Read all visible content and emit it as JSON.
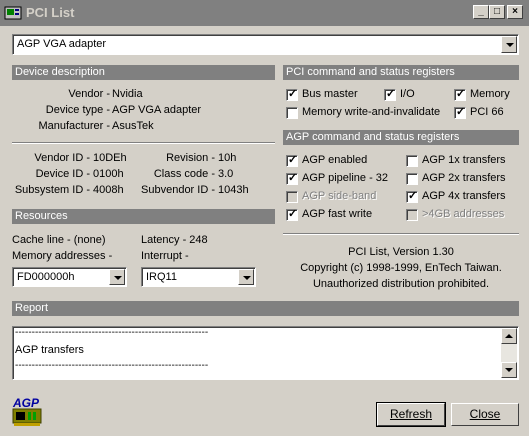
{
  "window": {
    "title": "PCI List"
  },
  "device_select": {
    "value": "AGP VGA adapter"
  },
  "device_description": {
    "header": "Device description",
    "vendor_label": "Vendor -",
    "vendor": "Nvidia",
    "type_label": "Device type -",
    "type": "AGP VGA adapter",
    "manufacturer_label": "Manufacturer -",
    "manufacturer": "AsusTek"
  },
  "ids": {
    "vendor_id_label": "Vendor ID -",
    "vendor_id": "10DEh",
    "device_id_label": "Device ID -",
    "device_id": "0100h",
    "subsystem_id_label": "Subsystem ID -",
    "subsystem_id": "4008h",
    "revision_label": "Revision -",
    "revision": "10h",
    "class_code_label": "Class code -",
    "class_code": "3.0",
    "subvendor_id_label": "Subvendor ID -",
    "subvendor_id": "1043h"
  },
  "resources": {
    "header": "Resources",
    "cache_line": "Cache line - (none)",
    "latency": "Latency - 248",
    "memory_addresses_label": "Memory addresses -",
    "interrupt_label": "Interrupt -",
    "memory_value": "FD000000h",
    "interrupt_value": "IRQ11"
  },
  "pci_registers": {
    "header": "PCI command and status registers",
    "items": [
      {
        "label": "Bus master",
        "checked": true,
        "disabled": false
      },
      {
        "label": "I/O",
        "checked": true,
        "disabled": false
      },
      {
        "label": "Memory",
        "checked": true,
        "disabled": false
      },
      {
        "label": "Memory write-and-invalidate",
        "checked": false,
        "disabled": false
      },
      {
        "label": "PCI 66",
        "checked": true,
        "disabled": false
      }
    ]
  },
  "agp_registers": {
    "header": "AGP command and status registers",
    "items": [
      {
        "label": "AGP enabled",
        "checked": true,
        "disabled": false
      },
      {
        "label": "AGP 1x transfers",
        "checked": false,
        "disabled": false
      },
      {
        "label": "AGP pipeline - 32",
        "checked": true,
        "disabled": false
      },
      {
        "label": "AGP 2x transfers",
        "checked": false,
        "disabled": false
      },
      {
        "label": "AGP side-band",
        "checked": false,
        "disabled": true
      },
      {
        "label": "AGP 4x transfers",
        "checked": true,
        "disabled": false
      },
      {
        "label": "AGP fast write",
        "checked": true,
        "disabled": false
      },
      {
        "label": ">4GB addresses",
        "checked": false,
        "disabled": true
      }
    ]
  },
  "about": {
    "line1": "PCI List, Version 1.30",
    "line2": "Copyright (c) 1998-1999, EnTech Taiwan.",
    "line3": "Unauthorized distribution prohibited."
  },
  "report": {
    "header": "Report",
    "dashes": "----------------------------------------------------------",
    "line": "AGP transfers"
  },
  "buttons": {
    "refresh": "Refresh",
    "close": "Close"
  },
  "logo": {
    "text": "AGP"
  }
}
